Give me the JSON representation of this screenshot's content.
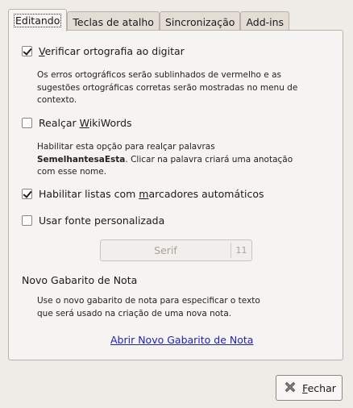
{
  "tabs": [
    {
      "label": "Editando"
    },
    {
      "label": "Teclas de atalho"
    },
    {
      "label": "Sincronização"
    },
    {
      "label": "Add-ins"
    }
  ],
  "options": {
    "spellcheck": {
      "checked": true,
      "pre": "",
      "mn": "V",
      "post": "erificar ortografia ao digitar",
      "desc1": "Os erros ortográficos serão sublinhados de vermelho e as",
      "desc2": "sugestões ortográficas corretas serão mostradas no menu de",
      "desc3": "contexto."
    },
    "wikiwords": {
      "checked": false,
      "pre": "Realçar ",
      "mn": "W",
      "post": "ikiWords",
      "desc1": "Habilitar esta opção para realçar palavras",
      "desc2_bold": "SemelhantesaEsta",
      "desc2_rest": ". Clicar na palavra criará uma anotação",
      "desc3": "com esse nome."
    },
    "bullets": {
      "checked": true,
      "pre": "Habilitar listas com ",
      "mn": "m",
      "post": "arcadores automáticos"
    },
    "customfont": {
      "checked": false,
      "label": "Usar fonte personalizada"
    }
  },
  "font": {
    "name": "Serif",
    "size": "11"
  },
  "template": {
    "title": "Novo Gabarito de Nota",
    "desc1": "Use o novo gabarito de nota para especificar o texto",
    "desc2": "que será usado na criação de uma nova nota.",
    "link": "Abrir Novo Gabarito de Nota"
  },
  "close": {
    "mn": "F",
    "rest": "echar"
  }
}
